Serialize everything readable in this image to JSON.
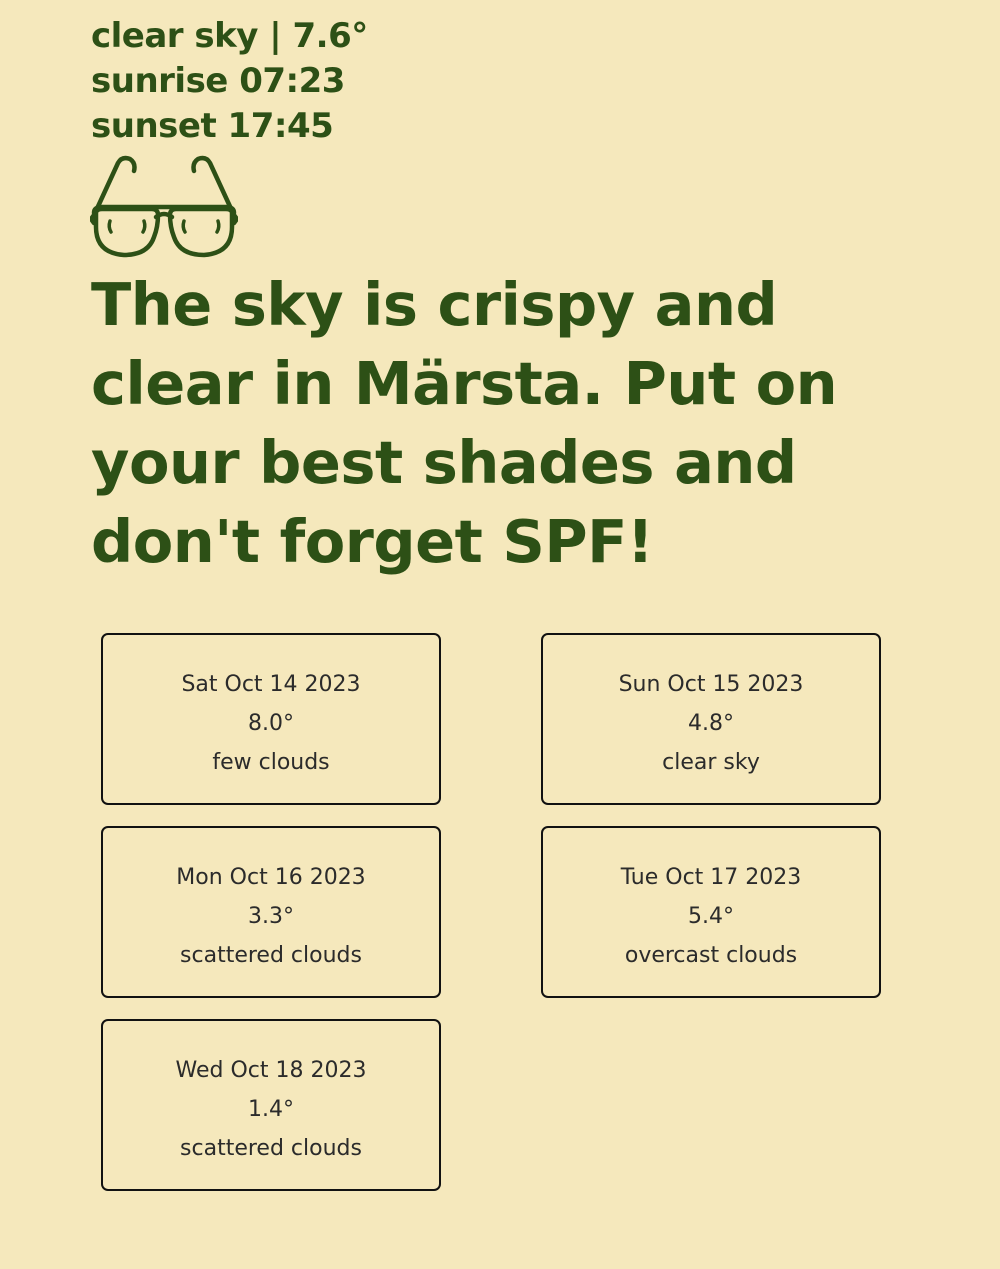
{
  "current": {
    "line1": "clear sky | 7.6°",
    "line2": "sunrise 07:23",
    "line3": "sunset 17:45"
  },
  "icon": "sunglasses-icon",
  "headline": "The sky is crispy and clear in Märsta. Put on your best shades and don't forget SPF!",
  "colors": {
    "background": "#f5e8bc",
    "accent": "#2d5016",
    "card_border": "#111111",
    "card_text": "#2b2b2b"
  },
  "forecast": [
    {
      "date": "Sat Oct 14 2023",
      "temp": "8.0°",
      "desc": "few clouds"
    },
    {
      "date": "Sun Oct 15 2023",
      "temp": "4.8°",
      "desc": "clear sky"
    },
    {
      "date": "Mon Oct 16 2023",
      "temp": "3.3°",
      "desc": "scattered clouds"
    },
    {
      "date": "Tue Oct 17 2023",
      "temp": "5.4°",
      "desc": "overcast clouds"
    },
    {
      "date": "Wed Oct 18 2023",
      "temp": "1.4°",
      "desc": "scattered clouds"
    }
  ]
}
